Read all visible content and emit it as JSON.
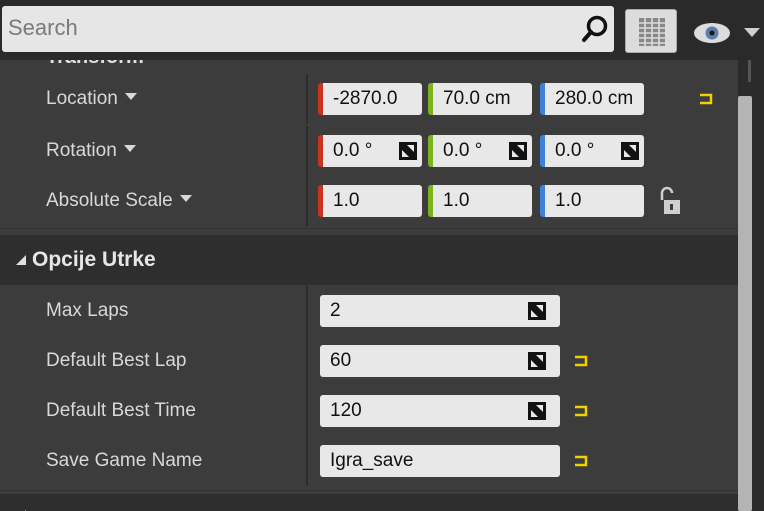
{
  "search": {
    "placeholder": "Search",
    "value": ""
  },
  "toolbar": {
    "search_icon": "search-icon",
    "view_options_icon": "grid-view-icon",
    "visibility_icon": "eye-icon"
  },
  "transform_section": {
    "title": "Transform",
    "rows": [
      {
        "label": "Location",
        "values": [
          "-2870.0",
          "70.0 cm",
          "280.0 cm"
        ],
        "has_reset": true
      },
      {
        "label": "Rotation",
        "values": [
          "0.0 °",
          "0.0 °",
          "0.0 °"
        ],
        "has_reset": false
      },
      {
        "label": "Absolute Scale",
        "values": [
          "1.0",
          "1.0",
          "1.0"
        ],
        "locked": false
      }
    ]
  },
  "race_options": {
    "title": "Opcije Utrke",
    "rows": [
      {
        "label": "Max Laps",
        "value": "2",
        "spinner": true,
        "has_reset": false
      },
      {
        "label": "Default Best Lap",
        "value": "60",
        "spinner": true,
        "has_reset": true
      },
      {
        "label": "Default Best Time",
        "value": "120",
        "spinner": true,
        "has_reset": true
      },
      {
        "label": "Save Game Name",
        "value": "Igra_save",
        "spinner": false,
        "has_reset": true
      }
    ]
  },
  "colors": {
    "axis_x": "#c8331f",
    "axis_y": "#7bb31e",
    "axis_z": "#3d82d8",
    "reset_arrow": "#f0d000",
    "panel_bg": "#3c3c3c",
    "category_bg": "#2e2e2e"
  }
}
